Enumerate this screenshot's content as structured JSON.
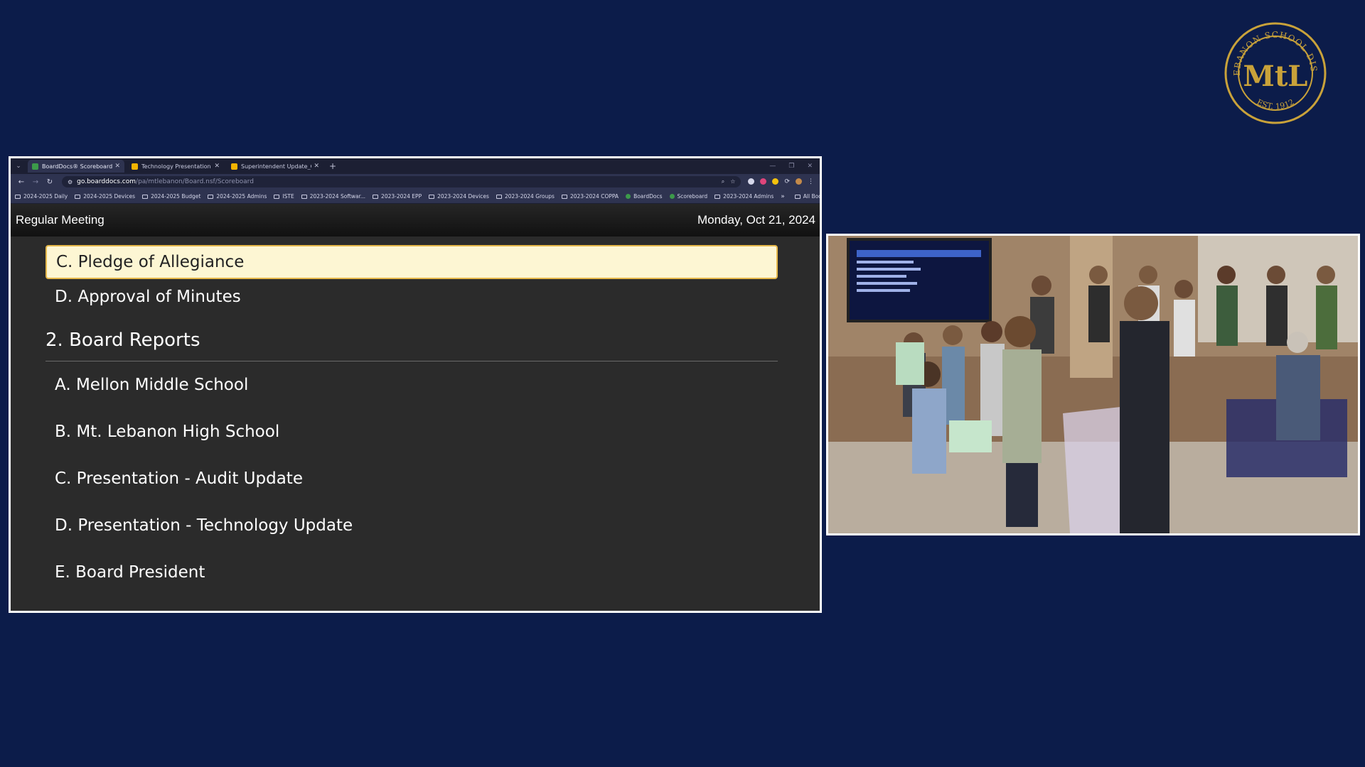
{
  "seal": {
    "top_text": "MT. LEBANON SCHOOL DISTRICT",
    "bottom_text": "EST. 1912",
    "monogram": "MtL",
    "color": "#c9a23a"
  },
  "browser": {
    "tabs": [
      {
        "title": "BoardDocs® Scoreboard",
        "favicon_color": "#3c9a4a",
        "active": true
      },
      {
        "title": "Technology Presentation - Sch",
        "favicon_color": "#f4b400",
        "active": false
      },
      {
        "title": "Superintendent Update_Octob",
        "favicon_color": "#f4b400",
        "active": false
      }
    ],
    "url_host": "go.boarddocs.com",
    "url_path": "/pa/mtlebanon/Board.nsf/Scoreboard",
    "bookmarks": [
      "2024-2025 Daily",
      "2024-2025 Devices",
      "2024-2025 Budget",
      "2024-2025 Admins",
      "ISTE",
      "2023-2024 Softwar...",
      "2023-2024 EPP",
      "2023-2024 Devices",
      "2023-2024 Groups",
      "2023-2024 COPPA",
      "BoardDocs",
      "Scoreboard",
      "2023-2024 Admins"
    ],
    "all_bookmarks": "All Bookmarks"
  },
  "meeting": {
    "title": "Regular Meeting",
    "date": "Monday, Oct 21, 2024"
  },
  "agenda": {
    "current": "C. Pledge of Allegiance",
    "item_d": "D. Approval of Minutes",
    "section": "2. Board Reports",
    "items": [
      "A. Mellon Middle School",
      "B. Mt. Lebanon High School",
      "C. Presentation - Audit Update",
      "D. Presentation - Technology Update",
      "E. Board President"
    ]
  },
  "colors": {
    "page_bg": "#0c1c4a",
    "highlight_bg": "#fdf6d3",
    "highlight_border": "#e6b84a"
  }
}
